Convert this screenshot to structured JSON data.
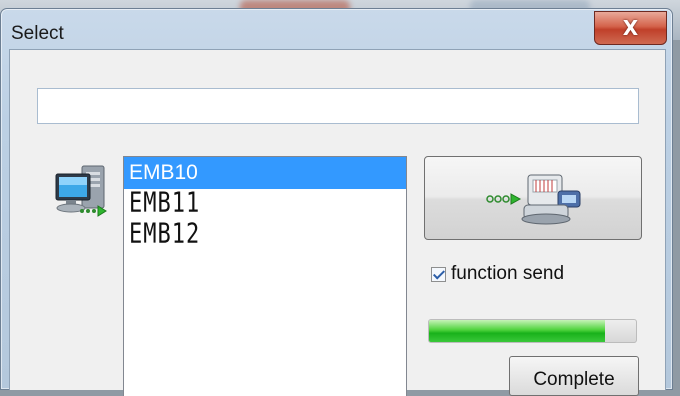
{
  "window": {
    "title": "Select",
    "close_label": "X"
  },
  "text_input": {
    "value": "",
    "placeholder": ""
  },
  "device_list": {
    "items": [
      {
        "label": "EMB10",
        "selected": true
      },
      {
        "label": "EMB11",
        "selected": false
      },
      {
        "label": "EMB12",
        "selected": false
      }
    ]
  },
  "icons": {
    "computer": "computer-send-icon",
    "send": "send-to-embroidery-machine-icon"
  },
  "function_send": {
    "label": "function send",
    "checked": true
  },
  "progress": {
    "fraction": 0.85
  },
  "complete_button": {
    "label": "Complete"
  },
  "colors": {
    "selection": "#3399ff",
    "progress": "#19b21b",
    "close_button": "#c0402a"
  }
}
